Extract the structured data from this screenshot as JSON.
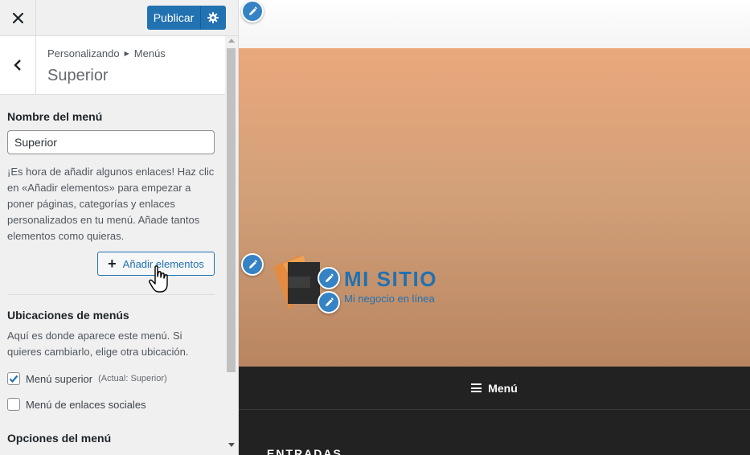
{
  "sidebar": {
    "close_icon": "close-icon",
    "publish_label": "Publicar",
    "publish_settings_icon": "gear-icon",
    "back_icon": "chevron-left-icon",
    "breadcrumb": {
      "root": "Personalizando",
      "separator_icon": "triangle-right-icon",
      "current": "Menús"
    },
    "section_title": "Superior",
    "menu_name_label": "Nombre del menú",
    "menu_name_value": "Superior",
    "help_text": "¡Es hora de añadir algunos enlaces! Haz clic en «Añadir elementos» para empezar a poner páginas, categorías y enlaces personalizados en tu menú. Añade tantos elementos como quieras.",
    "add_items_label": "Añadir elementos",
    "locations_title": "Ubicaciones de menús",
    "locations_desc": "Aquí es donde aparece este menú. Si quieres cambiarlo, elige otra ubicación.",
    "locations": [
      {
        "label": "Menú superior",
        "current": "(Actual: Superior)",
        "checked": true
      },
      {
        "label": "Menú de enlaces sociales",
        "current": "",
        "checked": false
      }
    ],
    "options_title": "Opciones del menú"
  },
  "preview": {
    "site_title": "MI SITIO",
    "site_tagline": "Mi negocio en línea",
    "nav_menu_label": "Menú",
    "entries_heading": "ENTRADAS",
    "edit_icon": "pencil-icon"
  },
  "colors": {
    "accent": "#2271b1",
    "shortcut_blue": "#3582c4",
    "hero_top": "#eaa87b",
    "hero_bottom": "#b88560",
    "nav_bg": "#222222"
  }
}
